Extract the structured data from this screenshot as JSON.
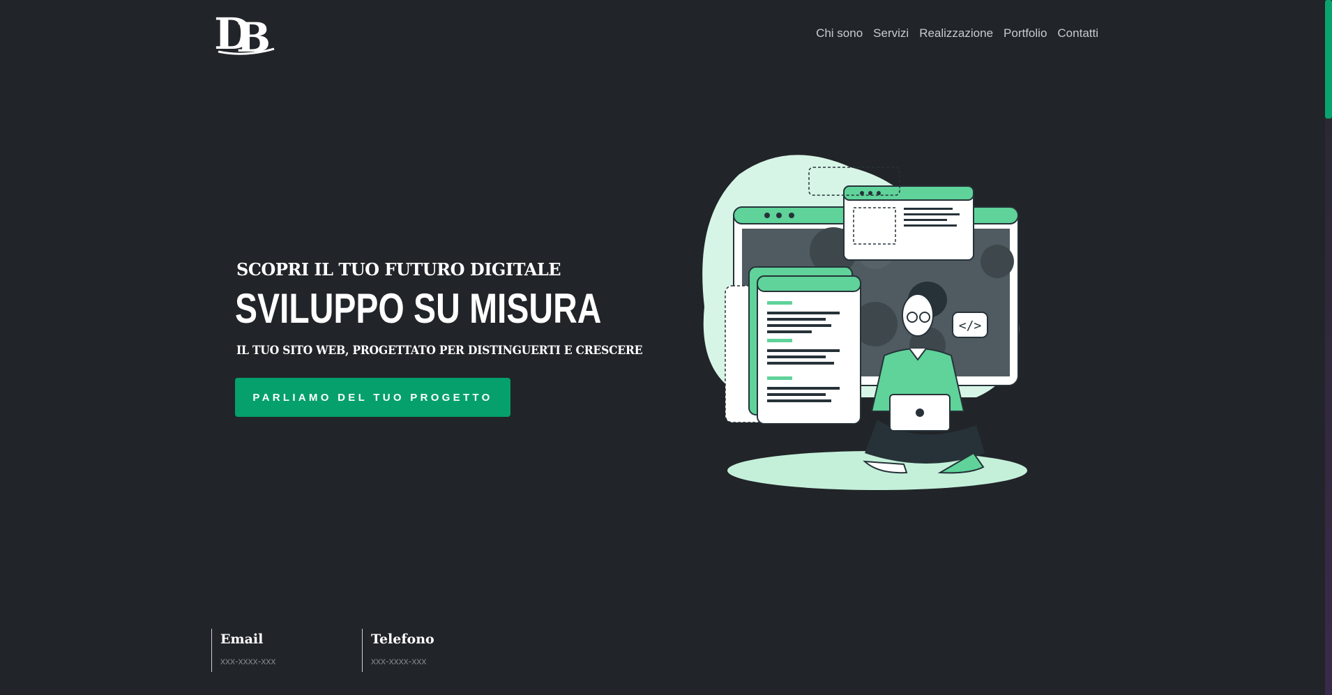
{
  "header": {
    "logo_text": "DB",
    "nav": [
      "Chi sono",
      "Servizi",
      "Realizzazione",
      "Portfolio",
      "Contatti"
    ]
  },
  "hero": {
    "pretitle": "SCOPRI IL TUO FUTURO DIGITALE",
    "title": "SVILUPPO SU MISURA",
    "subtitle": "IL TUO SITO WEB, PROGETTATO PER DISTINGUERTI E CRESCERE",
    "cta_label": "PARLIAMO DEL TUO PROGETTO"
  },
  "contacts": [
    {
      "label": "Email",
      "value": "xxx-xxxx-xxx"
    },
    {
      "label": "Telefono",
      "value": "xxx-xxxx-xxx"
    }
  ],
  "colors": {
    "background": "#212428",
    "accent": "#05a06b",
    "illustration_green": "#5fd39a",
    "illustration_light": "#d7f5e6"
  },
  "icons": [
    "logo-db",
    "developer-illustration"
  ]
}
